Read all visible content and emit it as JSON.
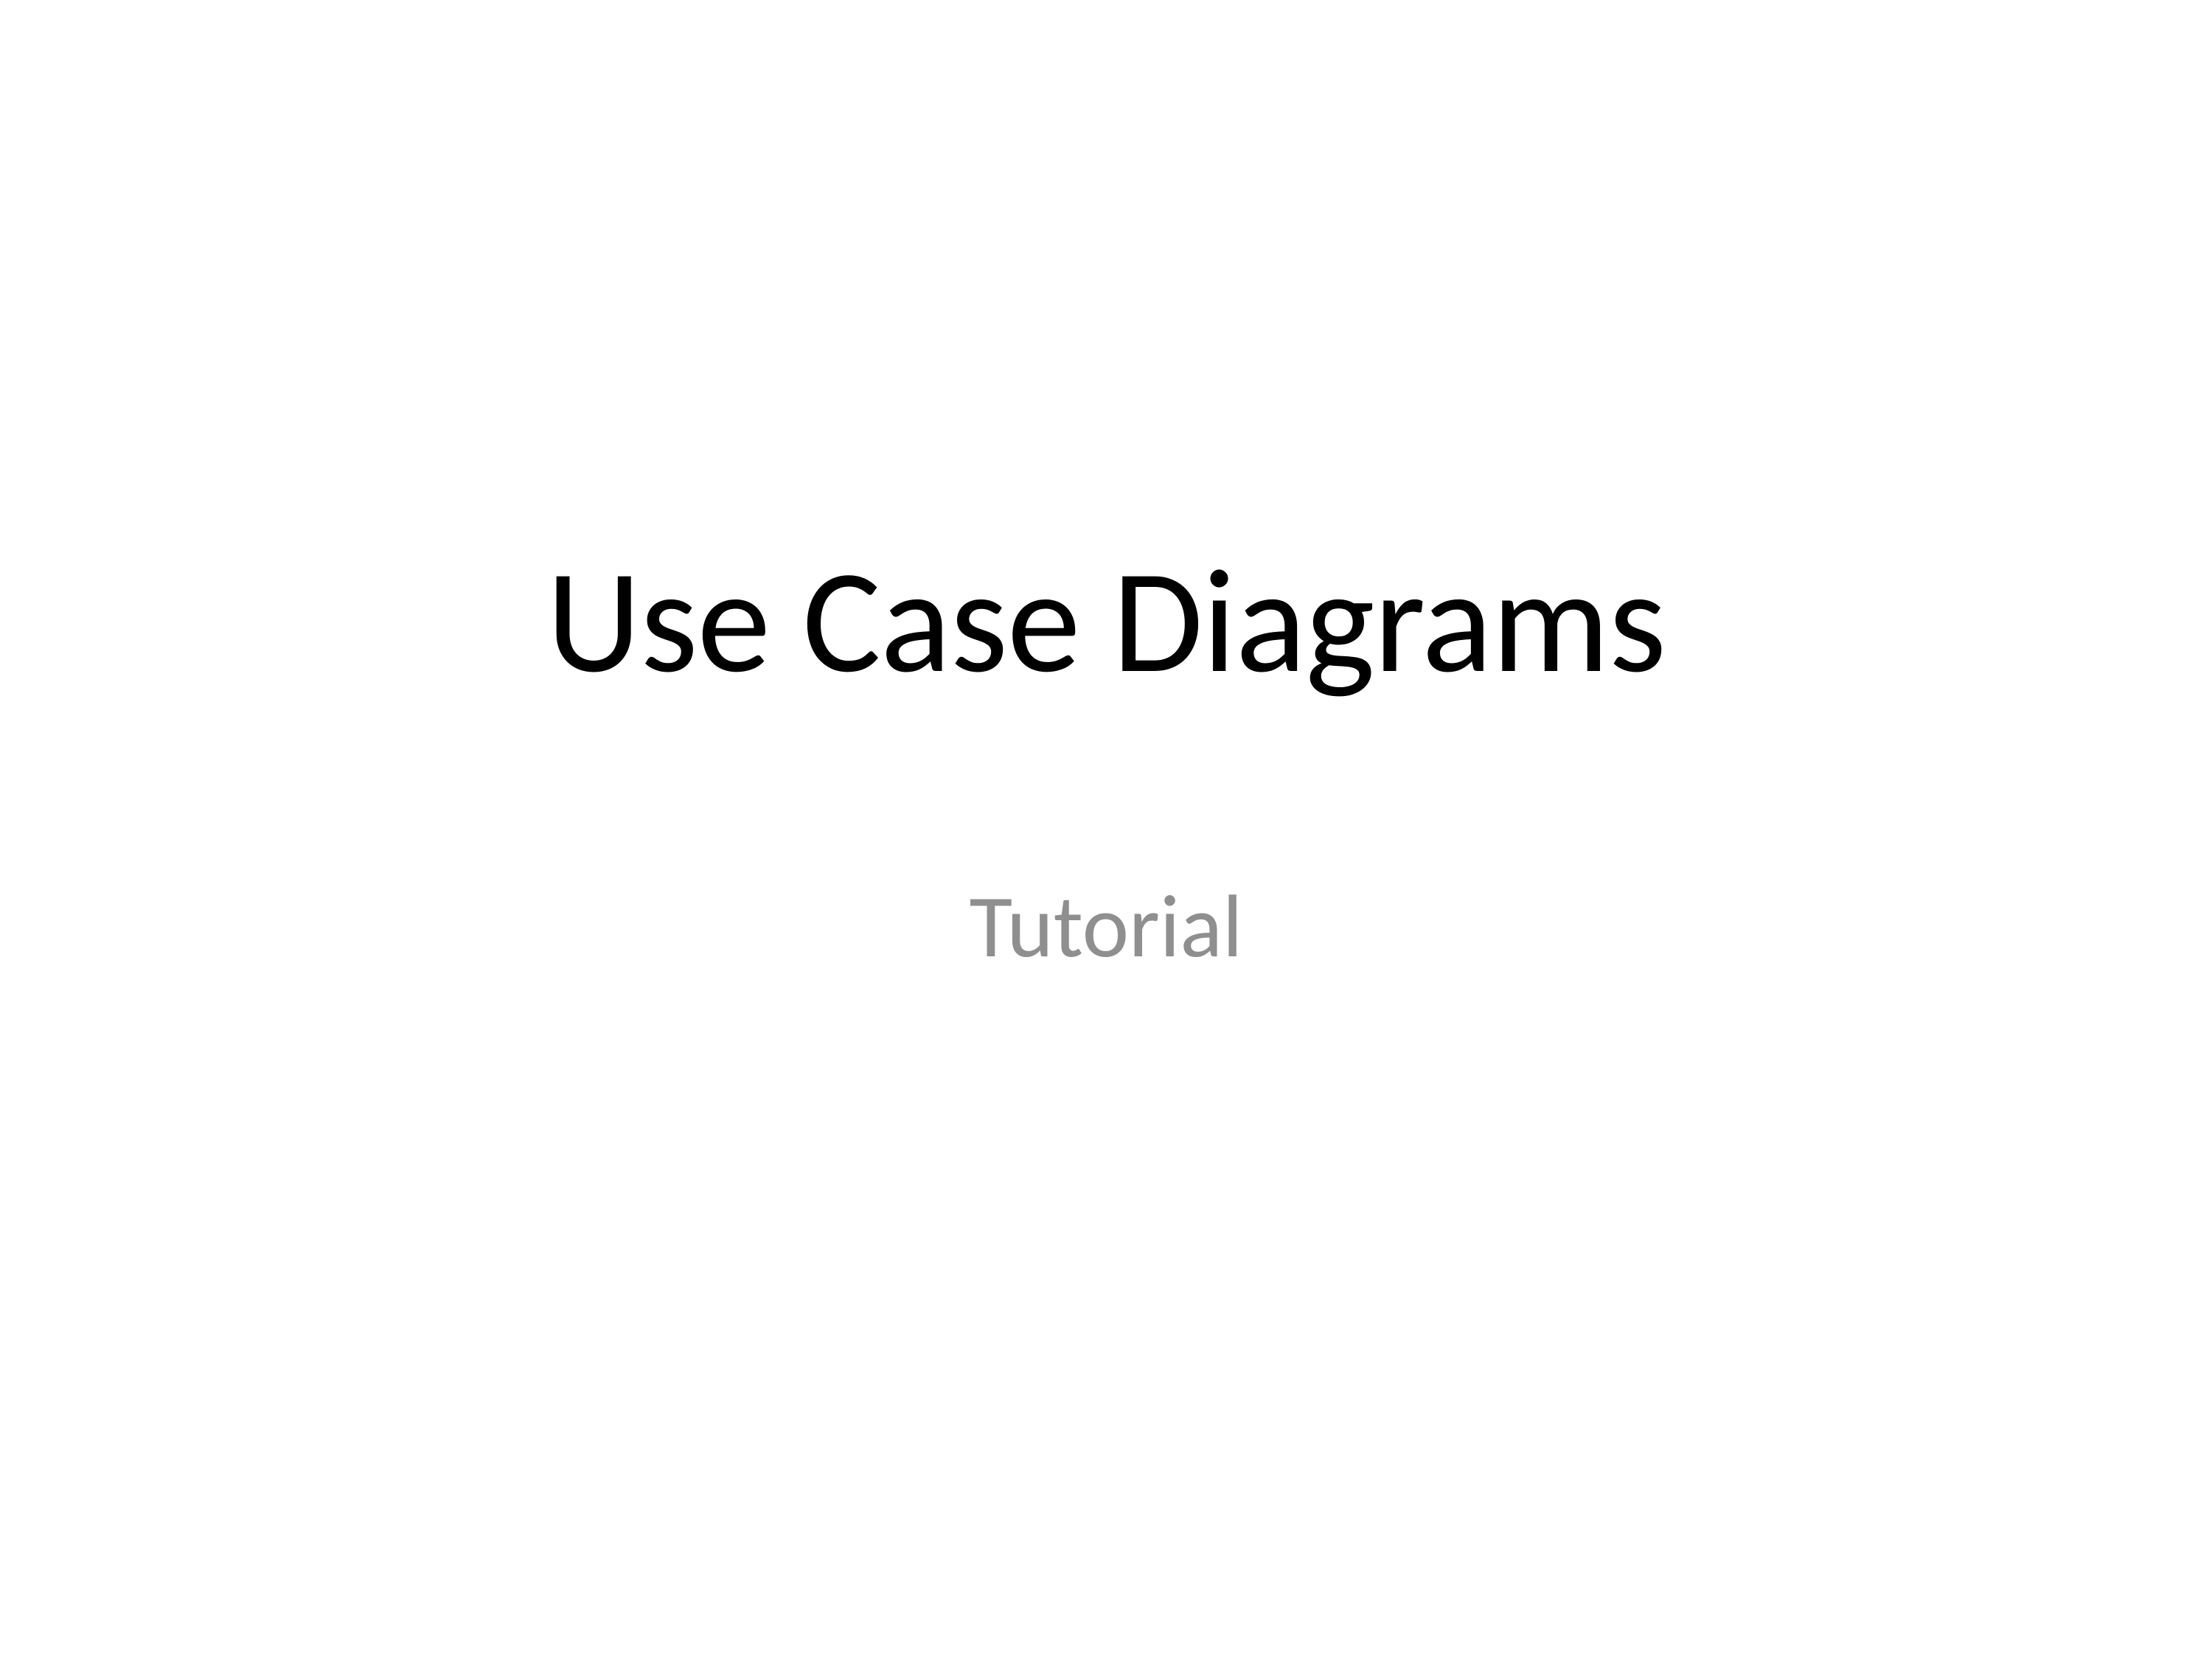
{
  "slide": {
    "title": "Use Case Diagrams",
    "subtitle": "Tutorial"
  }
}
